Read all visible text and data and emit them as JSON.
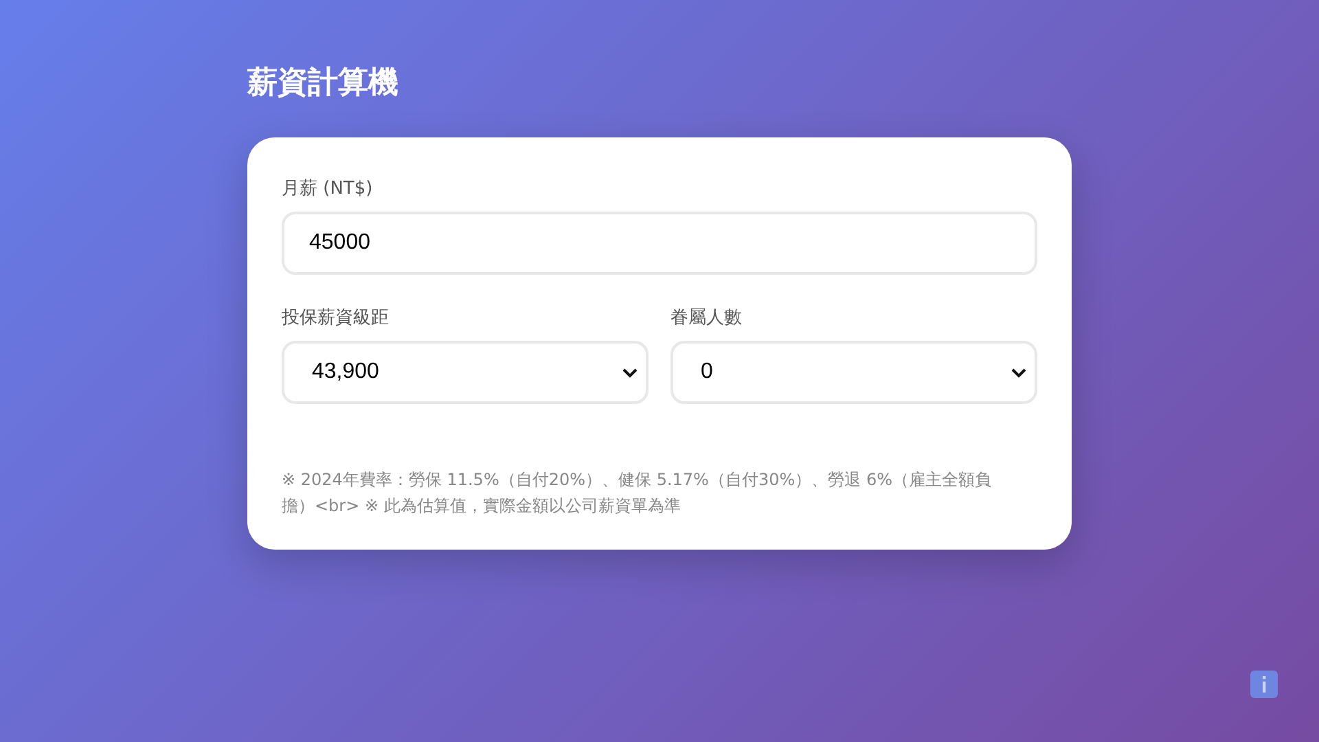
{
  "title": "薪資計算機",
  "salary": {
    "label": "月薪 (NT$)",
    "value": "45000"
  },
  "selects": [
    {
      "label": "投保薪資級距",
      "value": "43,900"
    },
    {
      "label": "眷屬人數",
      "value": "0"
    }
  ],
  "note": "※ 2024年費率：勞保 11.5%（自付20%）、健保 5.17%（自付30%）、勞退 6%（雇主全額負擔）<br> ※ 此為估算值，實際金額以公司薪資單為準"
}
